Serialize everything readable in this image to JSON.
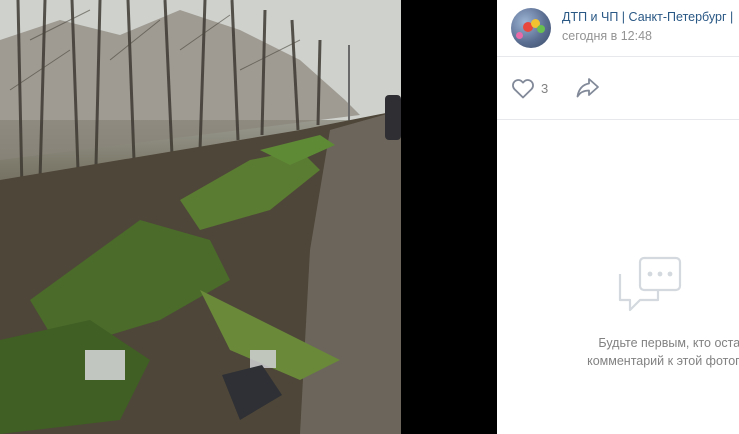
{
  "post": {
    "group_name": "ДТП и ЧП | Санкт-Петербург |",
    "time": "сегодня в 12:48",
    "likes": "3"
  },
  "comments": {
    "empty_text_line1": "Будьте первым, кто оставит",
    "empty_text_line2": "комментарий к этой фотографи"
  },
  "colors": {
    "link": "#2a5885",
    "muted": "#828282",
    "divider": "#e7e8ec"
  },
  "icons": {
    "like": "heart-outline-icon",
    "share": "share-arrow-icon",
    "empty": "speech-bubble-dots-icon"
  }
}
